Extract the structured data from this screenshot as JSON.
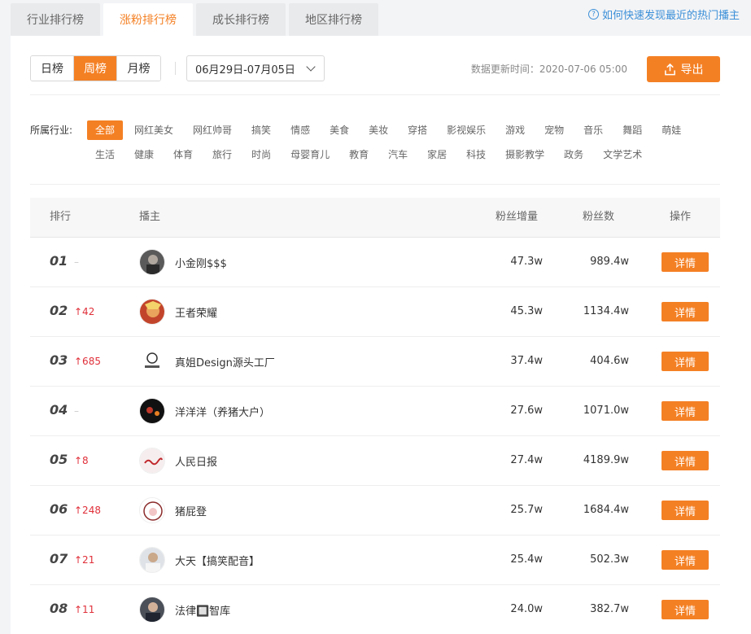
{
  "tabs": [
    {
      "label": "行业排行榜"
    },
    {
      "label": "涨粉排行榜"
    },
    {
      "label": "成长排行榜"
    },
    {
      "label": "地区排行榜"
    }
  ],
  "help_link": "如何快速发现最近的热门播主",
  "period": {
    "options": [
      "日榜",
      "周榜",
      "月榜"
    ],
    "selected": "周榜"
  },
  "date_range": "06月29日-07月05日",
  "update_time": "数据更新时间：2020-07-06 05:00",
  "export_label": "导出",
  "industry_label": "所属行业:",
  "industries_row1": [
    "全部",
    "网红美女",
    "网红帅哥",
    "搞笑",
    "情感",
    "美食",
    "美妆",
    "穿搭",
    "影视娱乐",
    "游戏",
    "宠物",
    "音乐",
    "舞蹈",
    "萌娃"
  ],
  "industries_row2": [
    "生活",
    "健康",
    "体育",
    "旅行",
    "时尚",
    "母婴育儿",
    "教育",
    "汽车",
    "家居",
    "科技",
    "摄影教学",
    "政务",
    "文学艺术"
  ],
  "table": {
    "headers": {
      "rank": "排行",
      "streamer": "播主",
      "increase": "粉丝增量",
      "fans": "粉丝数",
      "action": "操作"
    },
    "detail_label": "详情",
    "rows": [
      {
        "rank": "01",
        "change": "–",
        "up": false,
        "name": "小金刚$$$",
        "increase": "47.3w",
        "fans": "989.4w"
      },
      {
        "rank": "02",
        "change": "↑42",
        "up": true,
        "name": "王者荣耀",
        "increase": "45.3w",
        "fans": "1134.4w"
      },
      {
        "rank": "03",
        "change": "↑685",
        "up": true,
        "name": "真姐Design源头工厂",
        "increase": "37.4w",
        "fans": "404.6w"
      },
      {
        "rank": "04",
        "change": "–",
        "up": false,
        "name": "洋洋洋（养猪大户）",
        "increase": "27.6w",
        "fans": "1071.0w"
      },
      {
        "rank": "05",
        "change": "↑8",
        "up": true,
        "name": "人民日报",
        "increase": "27.4w",
        "fans": "4189.9w"
      },
      {
        "rank": "06",
        "change": "↑248",
        "up": true,
        "name": "猪屁登",
        "increase": "25.7w",
        "fans": "1684.4w"
      },
      {
        "rank": "07",
        "change": "↑21",
        "up": true,
        "name": "大天【搞笑配音】",
        "increase": "25.4w",
        "fans": "502.3w"
      },
      {
        "rank": "08",
        "change": "↑11",
        "up": true,
        "name": "法律🔲智库",
        "increase": "24.0w",
        "fans": "382.7w"
      }
    ]
  },
  "colors": {
    "accent": "#f48024",
    "up": "#e0303a",
    "link": "#3b8fd8"
  }
}
